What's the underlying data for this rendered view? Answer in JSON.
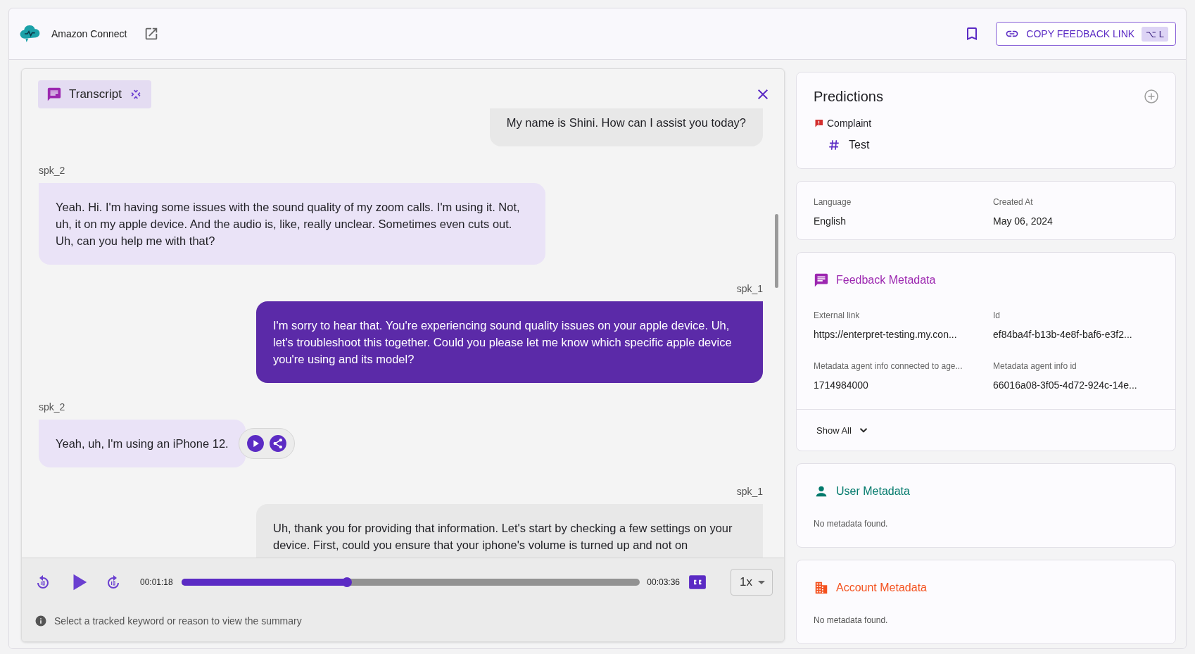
{
  "app": {
    "name": "Amazon Connect"
  },
  "header": {
    "copy_link": {
      "label": "COPY FEEDBACK LINK",
      "shortcut": "⌥ L"
    }
  },
  "transcript": {
    "title": "Transcript",
    "messages": [
      {
        "kind": "agent",
        "text": "My name is Shini. How can I assist you today?",
        "selected": false,
        "actions_shown": false
      },
      {
        "kind": "customer",
        "speaker": "spk_2",
        "text": "Yeah. Hi. I'm having some issues with the sound quality of my zoom calls. I'm using it. Not, uh, it on my apple device. And the audio is, like, really unclear. Sometimes even cuts out. Uh, can you help me with that?",
        "selected": false,
        "actions_shown": false
      },
      {
        "kind": "agent",
        "speaker": "spk_1",
        "text": "I'm sorry to hear that. You're experiencing sound quality issues on your apple device. Uh, let's troubleshoot this together. Could you please let me know which specific apple device you're using and its model?",
        "selected": true,
        "actions_shown": false
      },
      {
        "kind": "customer",
        "speaker": "spk_2",
        "text": "Yeah, uh, I'm using an iPhone 12.",
        "selected": false,
        "actions_shown": true
      },
      {
        "kind": "agent",
        "speaker": "spk_1",
        "text": "Uh, thank you for providing that information. Let's start by checking a few settings on your device. First, could you ensure that your iphone's volume is turned up and not on",
        "selected": false,
        "actions_shown": false
      }
    ]
  },
  "player": {
    "elapsed": "00:01:18",
    "duration": "00:03:36",
    "level": 0.361,
    "captions_on": true,
    "speed": "1x",
    "hint": "Select a tracked keyword or reason to view the summary"
  },
  "predictions": {
    "title": "Predictions",
    "items": [
      {
        "label": "Complaint",
        "children": [
          {
            "label": "Test"
          }
        ]
      }
    ]
  },
  "details": [
    {
      "label": "Language",
      "value": "English"
    },
    {
      "label": "Created At",
      "value": "May 06, 2024"
    }
  ],
  "metadata_sections": [
    {
      "kind": "feedback",
      "title": "Feedback Metadata",
      "color": "#9c27b0",
      "fields": [
        {
          "label": "External link",
          "value": "https://enterpret-testing.my.con..."
        },
        {
          "label": "Id",
          "value": "ef84ba4f-b13b-4e8f-baf6-e3f2..."
        },
        {
          "label": "Metadata agent info connected to age...",
          "value": "1714984000"
        },
        {
          "label": "Metadata agent info id",
          "value": "66016a08-3f05-4d72-924c-14e..."
        }
      ],
      "show_all": "Show All"
    },
    {
      "kind": "user",
      "title": "User Metadata",
      "color": "#00796b",
      "empty_text": "No metadata found."
    },
    {
      "kind": "account",
      "title": "Account Metadata",
      "color": "#f4511e",
      "empty_text": "No metadata found."
    }
  ]
}
